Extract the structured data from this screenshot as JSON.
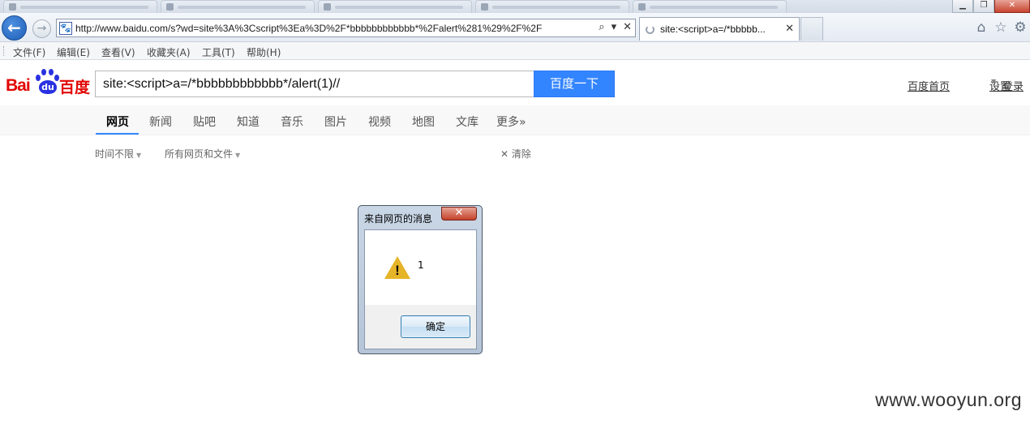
{
  "browser": {
    "address_url": "http://www.baidu.com/s?wd=site%3A%3Cscript%3Ea%3D%2F*bbbbbbbbbbbb*%2Falert%281%29%2F%2F",
    "active_tab_title": "site:<script>a=/*bbbbb...",
    "favicon_glyph": "🐾",
    "menu": [
      "文件(F)",
      "编辑(E)",
      "查看(V)",
      "收藏夹(A)",
      "工具(T)",
      "帮助(H)"
    ]
  },
  "baidu": {
    "logo": {
      "latin": "Bai",
      "paw": "du",
      "cn": "百度"
    },
    "query": "site:<script>a=/*bbbbbbbbbbbb*/alert(1)//",
    "search_button": "百度一下",
    "user_links": {
      "home": "百度首页",
      "settings": "设置",
      "login": "登录"
    },
    "tabs": [
      "网页",
      "新闻",
      "贴吧",
      "知道",
      "音乐",
      "图片",
      "视频",
      "地图",
      "文库",
      "更多»"
    ],
    "active_tab": "网页",
    "filters": {
      "time": "时间不限",
      "type": "所有网页和文件",
      "clear": "清除"
    },
    "accent": "#3385ff",
    "logo_red": "#e10602",
    "logo_blue": "#2932e1"
  },
  "dialog": {
    "title": "来自网页的消息",
    "icon": "warning-icon",
    "message": "1",
    "ok_label": "确定"
  },
  "watermark": "www.wooyun.org"
}
